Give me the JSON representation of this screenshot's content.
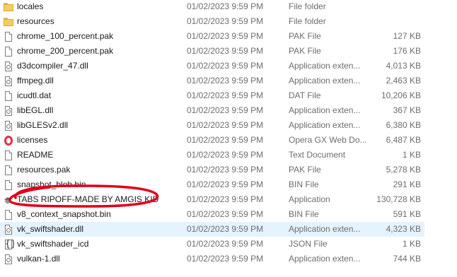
{
  "files": [
    {
      "name": "locales",
      "date": "01/02/2023 9:59 PM",
      "type": "File folder",
      "size": "",
      "icon": "folder-icon"
    },
    {
      "name": "resources",
      "date": "01/02/2023 9:59 PM",
      "type": "File folder",
      "size": "",
      "icon": "folder-icon"
    },
    {
      "name": "chrome_100_percent.pak",
      "date": "01/02/2023 9:59 PM",
      "type": "PAK File",
      "size": "127 KB",
      "icon": "file-icon"
    },
    {
      "name": "chrome_200_percent.pak",
      "date": "01/02/2023 9:59 PM",
      "type": "PAK File",
      "size": "176 KB",
      "icon": "file-icon"
    },
    {
      "name": "d3dcompiler_47.dll",
      "date": "01/02/2023 9:59 PM",
      "type": "Application exten...",
      "size": "4,013 KB",
      "icon": "dll-icon"
    },
    {
      "name": "ffmpeg.dll",
      "date": "01/02/2023 9:59 PM",
      "type": "Application exten...",
      "size": "2,463 KB",
      "icon": "dll-icon"
    },
    {
      "name": "icudtl.dat",
      "date": "01/02/2023 9:59 PM",
      "type": "DAT File",
      "size": "10,206 KB",
      "icon": "file-icon"
    },
    {
      "name": "libEGL.dll",
      "date": "01/02/2023 9:59 PM",
      "type": "Application exten...",
      "size": "367 KB",
      "icon": "dll-icon"
    },
    {
      "name": "libGLESv2.dll",
      "date": "01/02/2023 9:59 PM",
      "type": "Application exten...",
      "size": "6,380 KB",
      "icon": "dll-icon"
    },
    {
      "name": "licenses",
      "date": "01/02/2023 9:59 PM",
      "type": "Opera GX Web Do...",
      "size": "6,487 KB",
      "icon": "opera-icon"
    },
    {
      "name": "README",
      "date": "01/02/2023 9:59 PM",
      "type": "Text Document",
      "size": "1 KB",
      "icon": "file-icon"
    },
    {
      "name": "resources.pak",
      "date": "01/02/2023 9:59 PM",
      "type": "PAK File",
      "size": "5,278 KB",
      "icon": "file-icon"
    },
    {
      "name": "snapshot_blob.bin",
      "date": "01/02/2023 9:59 PM",
      "type": "BIN File",
      "size": "291 KB",
      "icon": "file-icon"
    },
    {
      "name": "TABS RIPOFF-MADE BY AMGIS KID",
      "date": "01/02/2023 9:59 PM",
      "type": "Application",
      "size": "130,728 KB",
      "icon": "app-icon"
    },
    {
      "name": "v8_context_snapshot.bin",
      "date": "01/02/2023 9:59 PM",
      "type": "BIN File",
      "size": "591 KB",
      "icon": "file-icon"
    },
    {
      "name": "vk_swiftshader.dll",
      "date": "01/02/2023 9:59 PM",
      "type": "Application exten...",
      "size": "4,323 KB",
      "icon": "dll-icon",
      "state": "hover"
    },
    {
      "name": "vk_swiftshader_icd",
      "date": "01/02/2023 9:59 PM",
      "type": "JSON File",
      "size": "1 KB",
      "icon": "json-icon"
    },
    {
      "name": "vulkan-1.dll",
      "date": "01/02/2023 9:59 PM",
      "type": "Application exten...",
      "size": "744 KB",
      "icon": "dll-icon"
    }
  ],
  "annotation_color": "#e0001b"
}
